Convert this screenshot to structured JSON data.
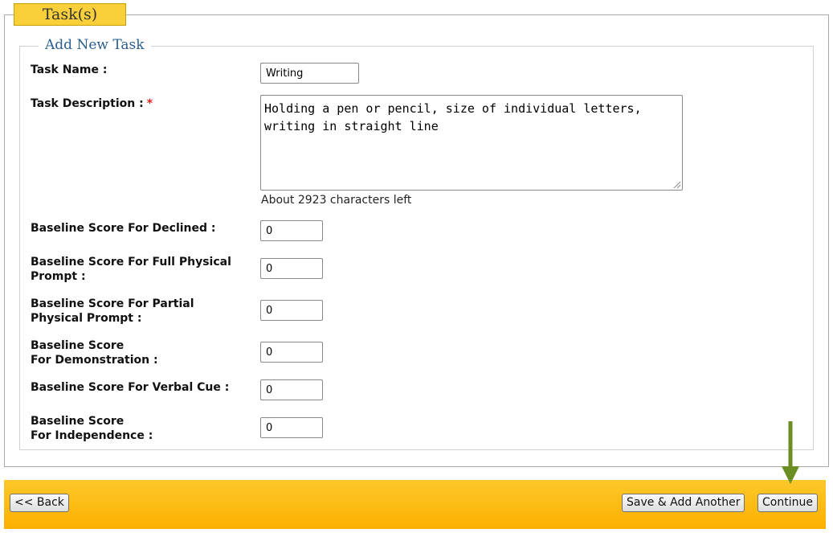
{
  "section": {
    "title": "Task(s)",
    "legend": "Add New Task"
  },
  "form": {
    "task_name_label": "Task Name :",
    "task_name_value": "Writing",
    "task_description_label": "Task Description :",
    "required_mark": "*",
    "task_description_value": "Holding a pen or pencil, size of individual letters, writing in straight line",
    "chars_left": "About 2923 characters left",
    "baselines": [
      {
        "label_line1": "Baseline Score For Declined :",
        "label_line2": "",
        "value": "0"
      },
      {
        "label_line1": "Baseline Score For Full Physical",
        "label_line2": "Prompt :",
        "value": "0"
      },
      {
        "label_line1": "Baseline Score For Partial",
        "label_line2": "Physical Prompt :",
        "value": "0"
      },
      {
        "label_line1": "Baseline Score",
        "label_line2": "For Demonstration :",
        "value": "0"
      },
      {
        "label_line1": "Baseline Score For Verbal Cue :",
        "label_line2": "",
        "value": "0"
      },
      {
        "label_line1": "Baseline Score",
        "label_line2": "For Independence :",
        "value": "0"
      }
    ]
  },
  "footer": {
    "back_label": "<< Back",
    "save_add_label": "Save & Add Another",
    "continue_label": "Continue"
  },
  "icons": {
    "annotation": "down-arrow-icon",
    "arrow_color": "#6b8e23"
  },
  "colors": {
    "tab": "#fad03a",
    "footer": "#fbb000",
    "legend": "#2a5f8f",
    "required": "#e02020"
  }
}
